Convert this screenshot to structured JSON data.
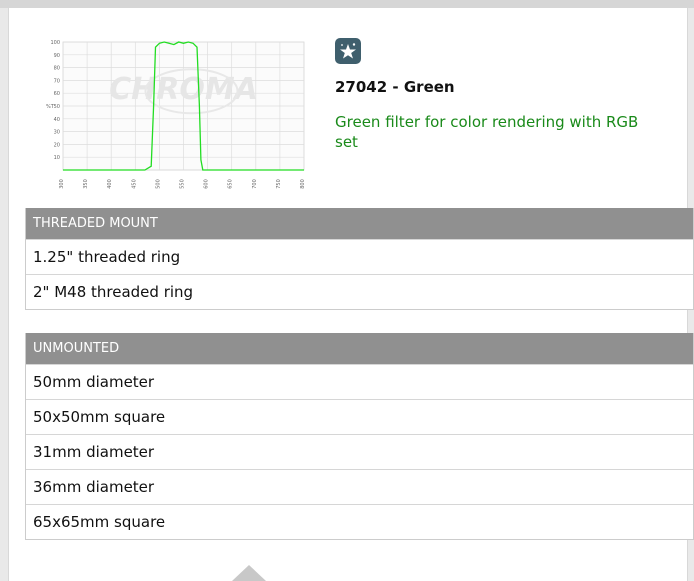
{
  "product": {
    "badge_icon": "sparkle-star-icon",
    "title": "27042 - Green",
    "description": "Green filter for color rendering with RGB set"
  },
  "chart_data": {
    "type": "line",
    "ylabel": "%T",
    "watermark": "CHROMA",
    "yticks": [
      10,
      20,
      30,
      40,
      50,
      60,
      70,
      80,
      90,
      100
    ],
    "xticks": [
      300,
      350,
      400,
      450,
      500,
      550,
      600,
      650,
      700,
      750,
      800
    ],
    "xlim": [
      300,
      800
    ],
    "ylim": [
      0,
      100
    ],
    "grid": true,
    "line_color": "#22dd22",
    "series": [
      {
        "x": [
          300,
          470,
          483,
          488,
          492,
          500,
          510,
          520,
          530,
          540,
          550,
          560,
          570,
          578,
          583,
          586,
          590,
          600,
          800
        ],
        "values": [
          0,
          0,
          3,
          50,
          96,
          99,
          100,
          99,
          98,
          100,
          99,
          100,
          99,
          96,
          50,
          8,
          0,
          0,
          0
        ]
      }
    ]
  },
  "sections": [
    {
      "header": "THREADED MOUNT",
      "items": [
        "1.25\" threaded ring",
        "2\" M48 threaded ring"
      ]
    },
    {
      "header": "UNMOUNTED",
      "items": [
        "50mm diameter",
        "50x50mm square",
        "31mm diameter",
        "36mm diameter",
        "65x65mm square"
      ]
    }
  ]
}
